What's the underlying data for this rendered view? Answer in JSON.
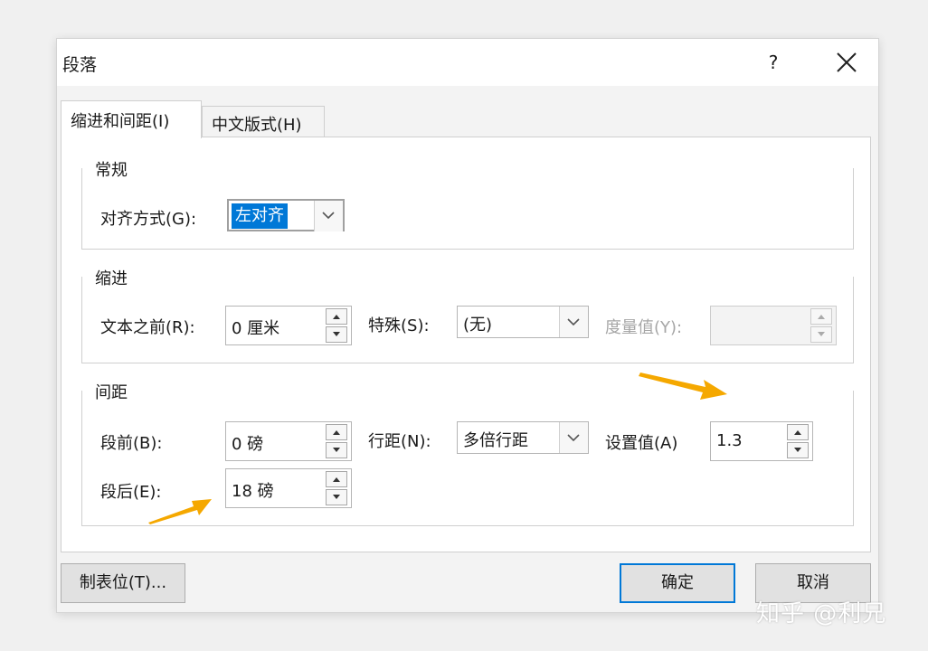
{
  "dialog": {
    "title": "段落",
    "help_label": "?",
    "tabs": [
      {
        "label": "缩进和间距(I)",
        "active": true
      },
      {
        "label": "中文版式(H)",
        "active": false
      }
    ]
  },
  "general": {
    "title": "常规",
    "alignment_label": "对齐方式(G):",
    "alignment_value": "左对齐"
  },
  "indent": {
    "title": "缩进",
    "before_text_label": "文本之前(R):",
    "before_text_value": "0 厘米",
    "special_label": "特殊(S):",
    "special_value": "(无)",
    "measure_label": "度量值(Y):",
    "measure_value": ""
  },
  "spacing": {
    "title": "间距",
    "before_label": "段前(B):",
    "before_value": "0 磅",
    "after_label": "段后(E):",
    "after_value": "18 磅",
    "line_spacing_label": "行距(N):",
    "line_spacing_value": "多倍行距",
    "set_value_label": "设置值(A)",
    "set_value": "1.3"
  },
  "buttons": {
    "tabs_label": "制表位(T)...",
    "ok_label": "确定",
    "cancel_label": "取消"
  },
  "watermark": "知乎 @利兄",
  "colors": {
    "selection": "#0078d7",
    "annotation_arrow": "#f5a800"
  }
}
